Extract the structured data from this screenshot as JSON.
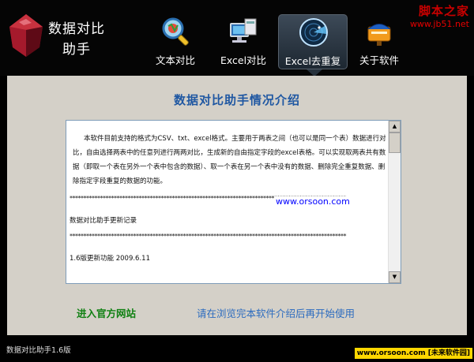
{
  "app": {
    "title_line1": "数据对比",
    "title_line2": "助手"
  },
  "nav": {
    "items": [
      {
        "label": "文本对比",
        "icon": "magnifier-icon"
      },
      {
        "label": "Excel对比",
        "icon": "computer-icon"
      },
      {
        "label": "Excel去重复",
        "icon": "radar-icon"
      },
      {
        "label": "关于软件",
        "icon": "mailbox-icon"
      }
    ],
    "active_index": 2
  },
  "watermark_top": {
    "name": "脚本之家",
    "url": "www.jb51.net"
  },
  "main": {
    "title": "数据对比助手情况介绍",
    "content": {
      "intro": "本软件目前支持的格式为CSV、txt、excel格式。主要用于两表之间（也可以是同一个表）数据进行对比，自由选择两表中的任意列进行两两对比，生成新的自由指定字段的excel表格。可以实现取两表共有数据（即取一个表在另外一个表中包含的数据）、取一个表在另一个表中没有的数据、删除完全重复数据、删除指定字段重复的数据的功能。",
      "separator": "****************************************************************************************************",
      "update_title": "数据对比助手更新记录",
      "version_line": "1.6版更新功能   2009.6.11",
      "watermark": "www.orsoon.com"
    },
    "official_link": "进入官方网站",
    "browse_hint": "请在浏览完本软件介绍后再开始使用"
  },
  "status": {
    "text": "数据对比助手1.6版",
    "badge": "www.orsoon.com [未来软件园]"
  },
  "colors": {
    "header_bg": "#050505",
    "panel_bg": "#d4d0c8",
    "title_blue": "#1f57a2",
    "link_green": "#0f8012",
    "hint_blue": "#2b6bbf",
    "watermark_red": "#c80000"
  }
}
